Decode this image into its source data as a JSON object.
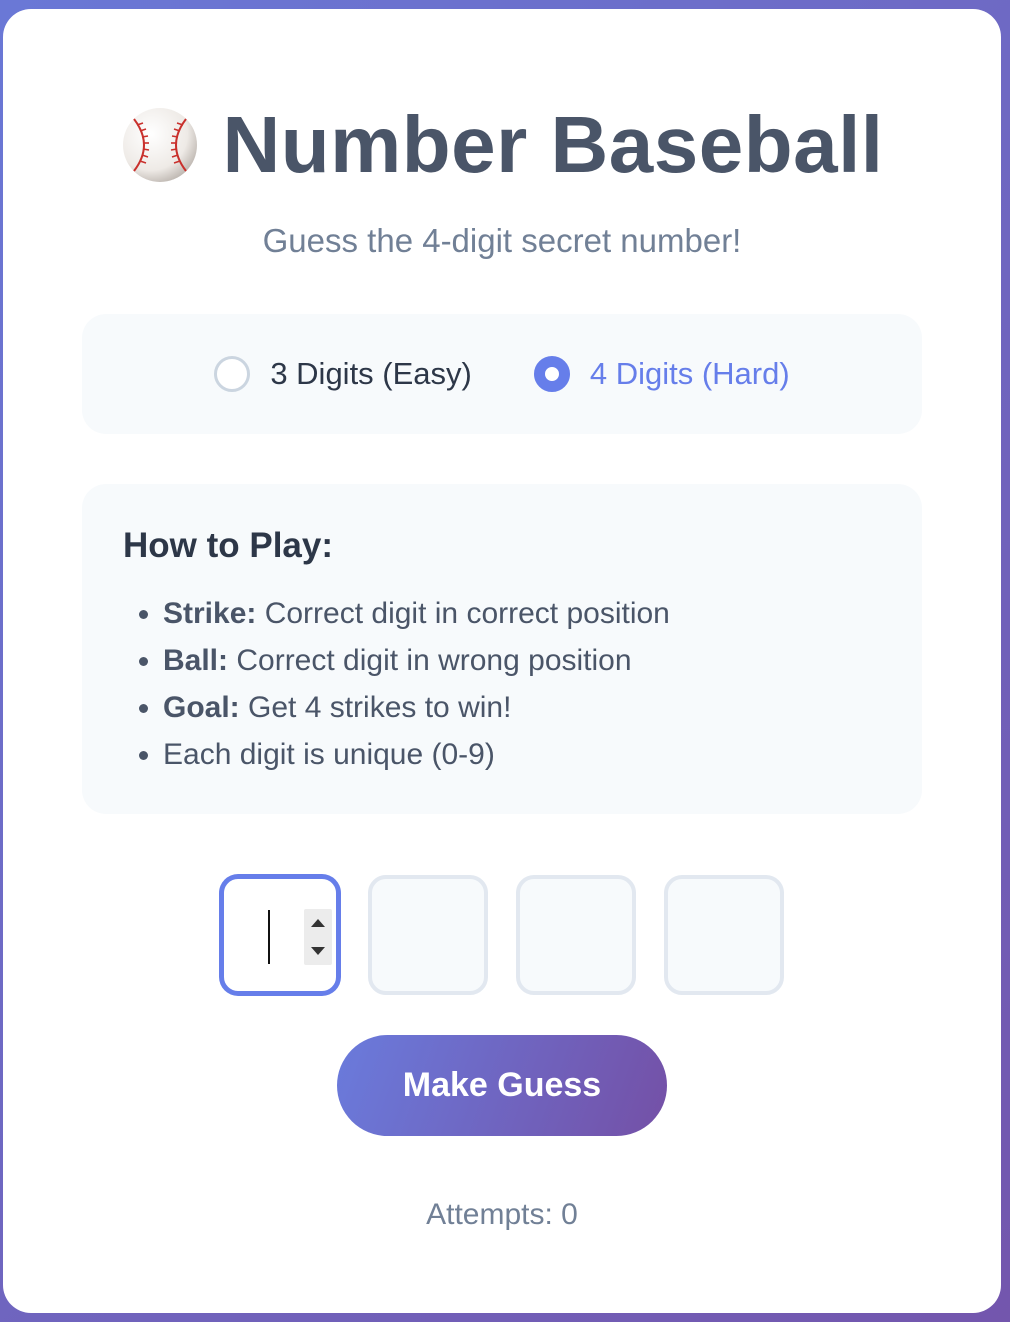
{
  "header": {
    "title": "Number Baseball",
    "subtitle": "Guess the 4-digit secret number!",
    "icon": "baseball-icon"
  },
  "mode": {
    "options": [
      {
        "label": "3 Digits (Easy)",
        "selected": false
      },
      {
        "label": "4 Digits (Hard)",
        "selected": true
      }
    ]
  },
  "rules": {
    "title": "How to Play:",
    "items": [
      {
        "term": "Strike:",
        "text": " Correct digit in correct position"
      },
      {
        "term": "Ball:",
        "text": " Correct digit in wrong position"
      },
      {
        "term": "Goal:",
        "text": " Get 4 strikes to win!"
      },
      {
        "term": "",
        "text": "Each digit is unique (0-9)"
      }
    ]
  },
  "digits": {
    "values": [
      "",
      "",
      "",
      ""
    ],
    "focused_index": 0
  },
  "actions": {
    "guess_label": "Make Guess"
  },
  "status": {
    "attempts_text": "Attempts: 0"
  },
  "colors": {
    "accent": "#667eea",
    "title": "#4a5568",
    "muted": "#718096",
    "panel": "#f7fafc"
  }
}
